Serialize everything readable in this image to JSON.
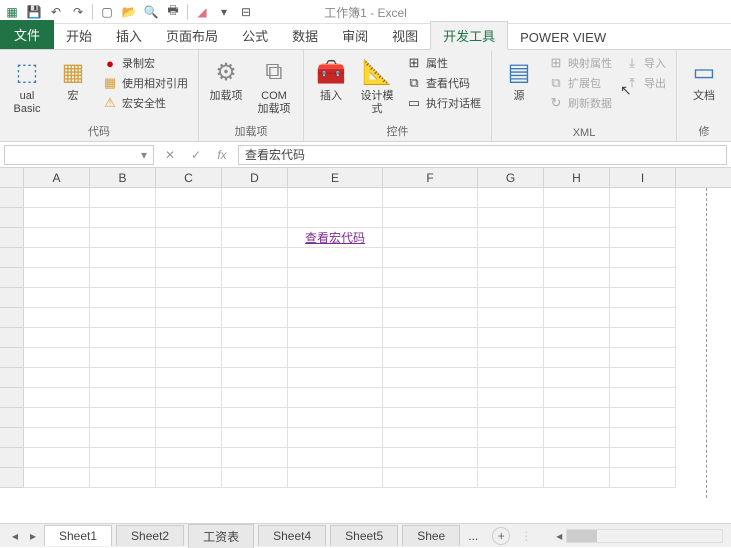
{
  "title": "工作簿1 - Excel",
  "tabs": {
    "file": "文件",
    "home": "开始",
    "insert": "插入",
    "pagelayout": "页面布局",
    "formulas": "公式",
    "data": "数据",
    "review": "审阅",
    "view": "视图",
    "developer": "开发工具",
    "powerview": "POWER VIEW"
  },
  "ribbon": {
    "code": {
      "vb": "Visual Basic",
      "vb1": "ual Basic",
      "macros": "宏",
      "record": "录制宏",
      "relative": "使用相对引用",
      "security": "宏安全性",
      "label": "代码"
    },
    "addins": {
      "addins": "加载项",
      "com": "COM 加载项",
      "label": "加载项"
    },
    "controls": {
      "insert": "插入",
      "design": "设计模式",
      "properties": "属性",
      "viewcode": "查看代码",
      "rundialog": "执行对话框",
      "label": "控件"
    },
    "xml": {
      "source": "源",
      "mapprops": "映射属性",
      "expansion": "扩展包",
      "refresh": "刷新数据",
      "import": "导入",
      "export": "导出",
      "label": "XML"
    },
    "modify": {
      "docpanel": "文档面板",
      "doc1": "文档",
      "label": "修"
    }
  },
  "formula_bar": {
    "fx": "fx",
    "value": "查看宏代码"
  },
  "columns": [
    "A",
    "B",
    "C",
    "D",
    "E",
    "F",
    "G",
    "H",
    "I"
  ],
  "cell_link": "查看宏代码",
  "sheets": [
    "Sheet1",
    "Sheet2",
    "工资表",
    "Sheet4",
    "Sheet5",
    "Shee"
  ],
  "sheets_more": "..."
}
